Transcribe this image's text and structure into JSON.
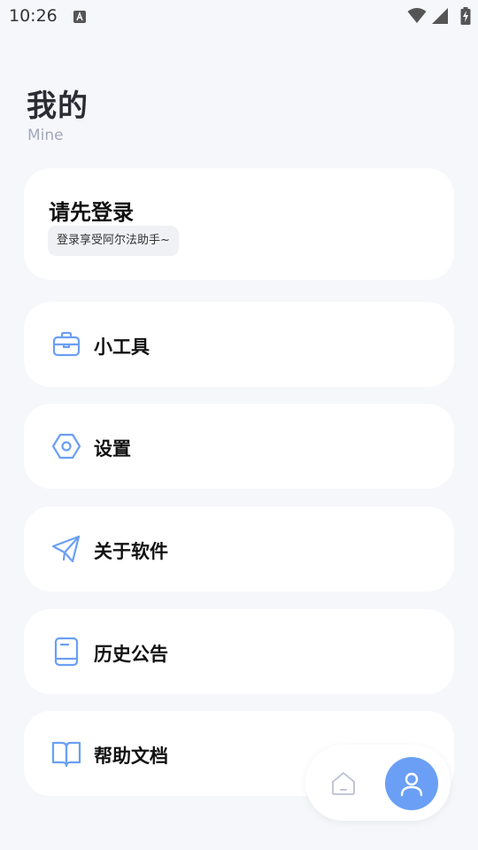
{
  "status_bar": {
    "time": "10:26",
    "notification_icon": "a-icon",
    "icons": [
      "wifi-icon",
      "signal-icon",
      "battery-charging-icon"
    ]
  },
  "header": {
    "title": "我的",
    "subtitle": "Mine"
  },
  "login": {
    "title": "请先登录",
    "tagline": "登录享受阿尔法助手~"
  },
  "menu": [
    {
      "label": "小工具",
      "icon": "briefcase-icon"
    },
    {
      "label": "设置",
      "icon": "settings-hexagon-icon"
    },
    {
      "label": "关于软件",
      "icon": "paper-plane-icon"
    },
    {
      "label": "历史公告",
      "icon": "notebook-icon"
    },
    {
      "label": "帮助文档",
      "icon": "open-book-icon"
    }
  ],
  "bottom_nav": {
    "items": [
      {
        "icon": "home-icon",
        "active": false
      },
      {
        "icon": "user-icon",
        "active": true
      }
    ]
  },
  "colors": {
    "accent": "#6a9ff5",
    "background": "#f6f7fb",
    "card": "#ffffff",
    "subtitle": "#a3a9bc"
  }
}
